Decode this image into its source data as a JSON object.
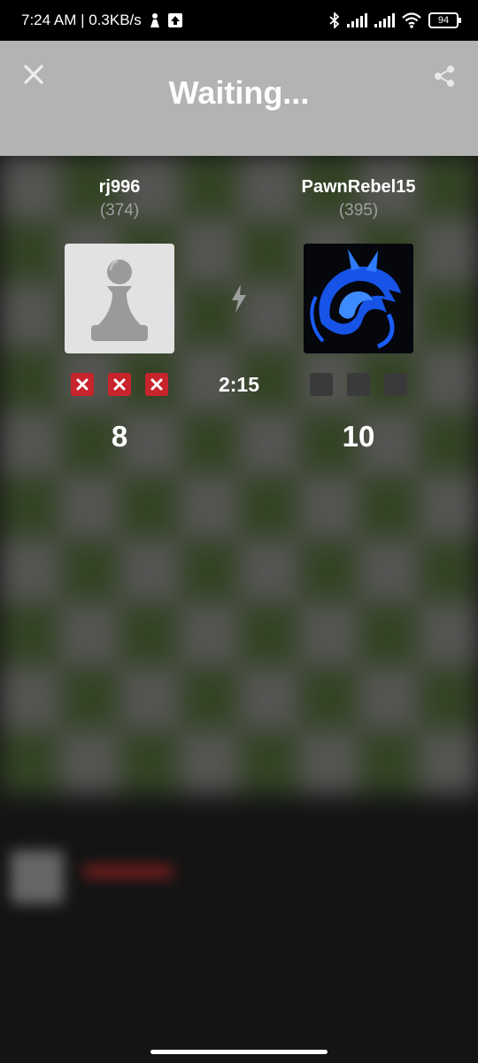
{
  "status_bar": {
    "time_speed": "7:24 AM | 0.3KB/s",
    "battery": "94"
  },
  "header": {
    "title": "Waiting..."
  },
  "players": {
    "left": {
      "name": "rj996",
      "rating": "(374)",
      "score": "8",
      "avatar_icon": "pawn-icon",
      "results": [
        "loss",
        "loss",
        "loss"
      ]
    },
    "right": {
      "name": "PawnRebel15",
      "rating": "(395)",
      "score": "10",
      "avatar_icon": "dragon-icon",
      "results": [
        "empty",
        "empty",
        "empty"
      ]
    }
  },
  "match": {
    "mode_icon": "bolt-icon",
    "timer": "2:15"
  },
  "colors": {
    "header_bg": "#b3b3b3",
    "loss_red": "#c7242b",
    "board_light": "#8a8a86",
    "board_dark": "#4d6a33"
  }
}
